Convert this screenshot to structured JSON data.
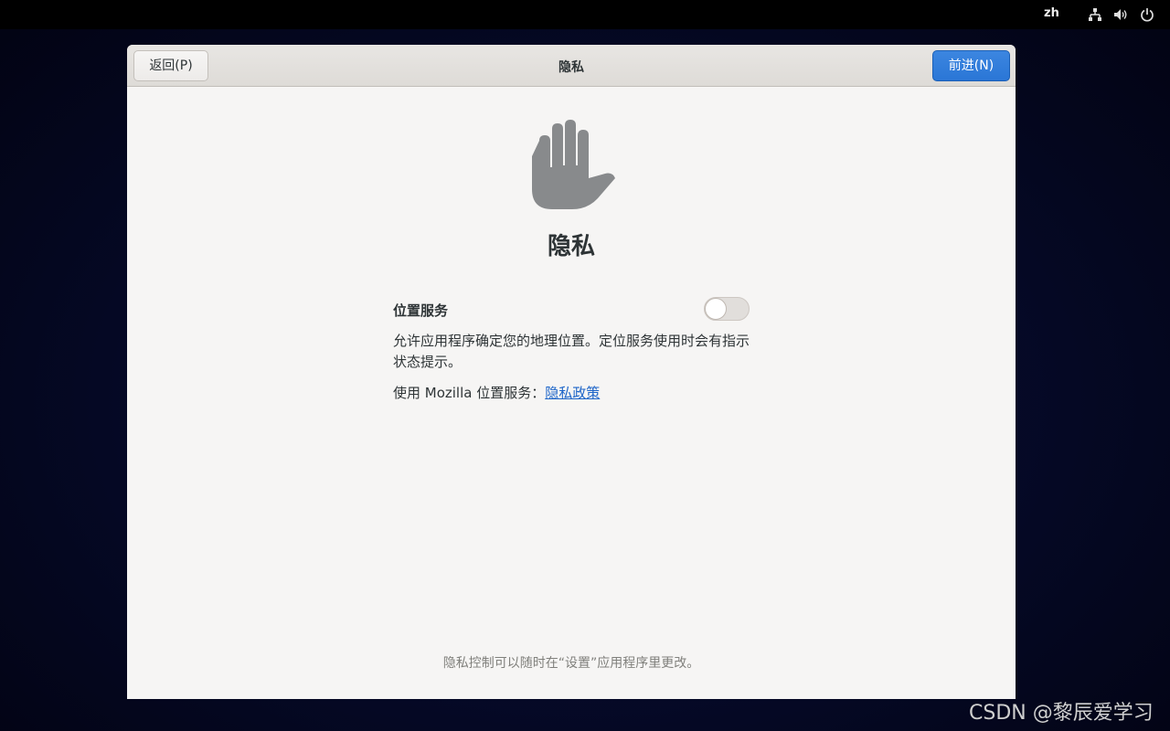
{
  "topbar": {
    "language": "zh",
    "icons": [
      "network-icon",
      "volume-icon",
      "power-icon"
    ]
  },
  "window": {
    "title": "隐私",
    "back_button": "返回(P)",
    "next_button": "前进(N)"
  },
  "content": {
    "icon": "hand-icon",
    "heading": "隐私",
    "location_label": "位置服务",
    "location_enabled": false,
    "description": "允许应用程序确定您的地理位置。定位服务使用时会有指示状态提示。",
    "mozilla_prefix": "使用 Mozilla 位置服务：",
    "policy_link": "隐私政策",
    "footer_note": "隐私控制可以随时在“设置”应用程序里更改。"
  },
  "watermark": "CSDN @黎辰爱学习",
  "colors": {
    "accent": "#2a76d6",
    "link": "#1c64c8",
    "icon_gray": "#888a8c"
  }
}
